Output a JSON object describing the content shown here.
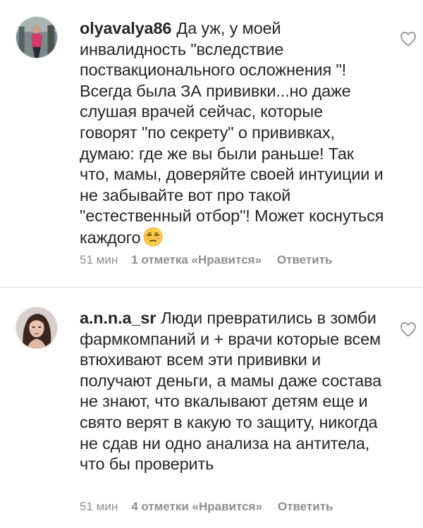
{
  "comments": [
    {
      "username": "olyavalya86",
      "text": "Да уж, у моей инвалидность \"вследствие поствакционального осложнения \"! Всегда была ЗА прививки...но даже слушая врачей сейчас, которые говорят \"по секрету\" о прививках, думаю: где же вы были раньше! Так что, мамы, доверяйте своей интуиции и не забывайте вот про такой \"естественный отбор\"! Может коснуться каждого",
      "emoji": "unamused-face-emoji",
      "time": "51 мин",
      "likes": "1 отметка «Нравится»",
      "reply": "Ответить",
      "like_icon": "heart-outline-icon"
    },
    {
      "username": "a.n.n.a_sr",
      "text": "Люди превратились в зомби фармкомпаний и + врачи которые всем втюхивают всем эти прививки  и получают деньги, а мамы даже состава не знают, что вкалывают детям еще и свято верят в какую то защиту, никогда не сдав ни одно анализа на антитела, что бы проверить",
      "time": "51 мин",
      "likes": "4 отметки «Нравится»",
      "reply": "Ответить",
      "like_icon": "heart-outline-icon"
    }
  ],
  "colors": {
    "text": "#262626",
    "meta": "#8e8e8e",
    "divider": "#e6e6e6",
    "background": "#ffffff"
  }
}
